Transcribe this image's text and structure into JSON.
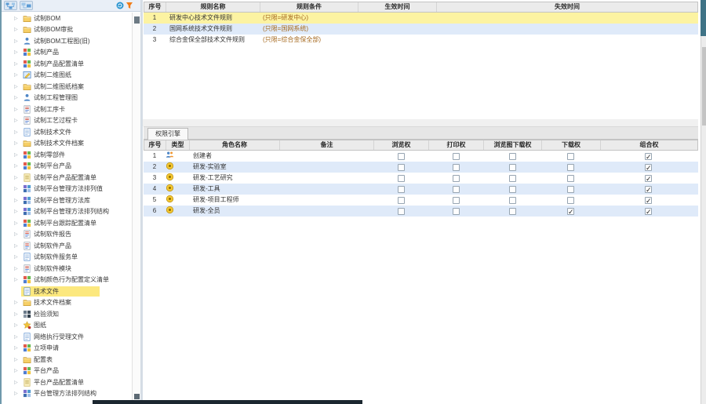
{
  "sidebar": {
    "toolbar": {
      "buttons": [
        {
          "name": "expand-tree-button",
          "icon": "tree1-icon"
        },
        {
          "name": "locate-node-button",
          "icon": "tree2-icon"
        }
      ],
      "right_icons": [
        {
          "name": "refresh-icon"
        },
        {
          "name": "filter-icon"
        }
      ]
    },
    "selected_index": 24,
    "items": [
      {
        "label": "试制BOM",
        "icon": "folder",
        "expandable": true
      },
      {
        "label": "试制BOM审批",
        "icon": "folder",
        "expandable": true
      },
      {
        "label": "试制BOM工程图(旧)",
        "icon": "org",
        "expandable": true
      },
      {
        "label": "试制产品",
        "icon": "grid",
        "expandable": true
      },
      {
        "label": "试制产品配置清单",
        "icon": "grid",
        "expandable": true
      },
      {
        "label": "试制二维图纸",
        "icon": "drawing",
        "expandable": true
      },
      {
        "label": "试制二维图纸档案",
        "icon": "folder",
        "expandable": true
      },
      {
        "label": "试制工程管理图",
        "icon": "org",
        "expandable": true
      },
      {
        "label": "试制工序卡",
        "icon": "doc-chart",
        "expandable": true
      },
      {
        "label": "试制工艺过程卡",
        "icon": "doc-chart",
        "expandable": true
      },
      {
        "label": "试制技术文件",
        "icon": "doc-blue",
        "expandable": true
      },
      {
        "label": "试制技术文件档案",
        "icon": "folder",
        "expandable": true
      },
      {
        "label": "试制零部件",
        "icon": "grid",
        "expandable": true
      },
      {
        "label": "试制平台产品",
        "icon": "grid",
        "expandable": true
      },
      {
        "label": "试制平台产品配置清单",
        "icon": "doc-yellow",
        "expandable": true
      },
      {
        "label": "试制平台管理方法排列值",
        "icon": "grid-blue",
        "expandable": true
      },
      {
        "label": "试制平台管理方法库",
        "icon": "grid-blue",
        "expandable": true
      },
      {
        "label": "试制平台管理方法排列结构",
        "icon": "grid-blue",
        "expandable": true
      },
      {
        "label": "试制平台跟踪配置清单",
        "icon": "grid",
        "expandable": true
      },
      {
        "label": "试制软件报告",
        "icon": "doc-chart",
        "expandable": true
      },
      {
        "label": "试制软件产品",
        "icon": "doc-chart",
        "expandable": true
      },
      {
        "label": "试制软件服务单",
        "icon": "doc-blue",
        "expandable": true
      },
      {
        "label": "试制软件模块",
        "icon": "doc-chart",
        "expandable": true
      },
      {
        "label": "试制颜色行为配置定义清单",
        "icon": "grid",
        "expandable": true
      },
      {
        "label": "技术文件",
        "icon": "doc-blue",
        "expandable": false
      },
      {
        "label": "技术文件档案",
        "icon": "folder",
        "expandable": true
      },
      {
        "label": "检验须知",
        "icon": "grid-dark",
        "expandable": true
      },
      {
        "label": "图纸",
        "icon": "star",
        "expandable": true
      },
      {
        "label": "网络执行受理文件",
        "icon": "doc-blue",
        "expandable": true
      },
      {
        "label": "立项申请",
        "icon": "grid",
        "expandable": true
      },
      {
        "label": "配置表",
        "icon": "folder",
        "expandable": true
      },
      {
        "label": "平台产品",
        "icon": "grid",
        "expandable": true
      },
      {
        "label": "平台产品配置清单",
        "icon": "doc-yellow",
        "expandable": true
      },
      {
        "label": "平台管理方法排列结构",
        "icon": "grid-blue",
        "expandable": true
      }
    ]
  },
  "top_table": {
    "columns": [
      "序号",
      "规则名称",
      "规则条件",
      "生效时间",
      "失效时间"
    ],
    "rows": [
      {
        "no": "1",
        "name": "研发中心技术文件规则",
        "condition": "(只限=研发中心)",
        "effective": "",
        "expire": "",
        "highlight": "yellow"
      },
      {
        "no": "2",
        "name": "国网系统技术文件规则",
        "condition": "(只限=国网系统)",
        "effective": "",
        "expire": "",
        "highlight": "blue"
      },
      {
        "no": "3",
        "name": "综合金保全部技术文件规则",
        "condition": "(只限=综合金保全部)",
        "effective": "",
        "expire": "",
        "highlight": "none"
      }
    ]
  },
  "bottom_panel": {
    "tab": "权限引擎",
    "columns": [
      "序号",
      "类型",
      "角色名称",
      "备注",
      "浏览权",
      "打印权",
      "浏览图下载权",
      "下载权",
      "组合权"
    ],
    "rows": [
      {
        "no": "1",
        "type": "group",
        "name": "创建者",
        "remark": "",
        "perms": [
          false,
          false,
          false,
          false,
          true
        ]
      },
      {
        "no": "2",
        "type": "role",
        "name": "研发-实验室",
        "remark": "",
        "perms": [
          false,
          false,
          false,
          false,
          true
        ]
      },
      {
        "no": "3",
        "type": "role",
        "name": "研发-工艺研究",
        "remark": "",
        "perms": [
          false,
          false,
          false,
          false,
          true
        ]
      },
      {
        "no": "4",
        "type": "role",
        "name": "研发-工具",
        "remark": "",
        "perms": [
          false,
          false,
          false,
          false,
          true
        ]
      },
      {
        "no": "5",
        "type": "role",
        "name": "研发-项目工程师",
        "remark": "",
        "perms": [
          false,
          false,
          false,
          false,
          true
        ]
      },
      {
        "no": "6",
        "type": "role",
        "name": "研发-全员",
        "remark": "",
        "perms": [
          false,
          false,
          false,
          true,
          true
        ]
      }
    ]
  },
  "colors": {
    "window_border": "#6f99ac",
    "corner_teal": "#3f7386",
    "row_highlight_yellow": "#fcf3a2",
    "row_alt_blue": "#dfeaf9",
    "tree_selected_yellow": "#fce87e",
    "header_gray": "#ebebeb",
    "condition_text": "#a5681e"
  }
}
